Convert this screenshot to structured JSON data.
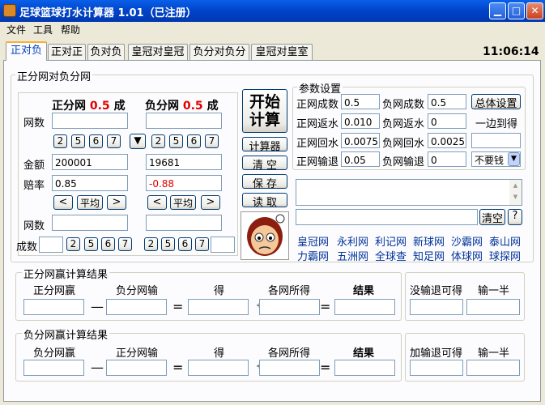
{
  "window": {
    "title": "足球篮球打水计算器 1.01（已注册）"
  },
  "menu": [
    "文件",
    "工具",
    "帮助"
  ],
  "tabs": [
    "正对负",
    "正对正",
    "负对负",
    "皇冠对皇冠",
    "负分对负分",
    "皇冠对皇室"
  ],
  "clock": "11:06:14",
  "main": {
    "group_title": "正分网对负分网",
    "left_header": "正分网",
    "right_header": "负分网",
    "left_handicap": "0.5",
    "right_handicap": "0.5",
    "cheng": "成",
    "label_wangshu": "网数",
    "label_amount": "金额",
    "label_rate": "赔率",
    "label_wangshu2": "网数",
    "label_chengshu": "成数",
    "left_amount": "200001",
    "right_amount": "19681",
    "left_rate": "0.85",
    "right_rate": "-0.88",
    "chips": [
      "2",
      "5",
      "6",
      "7"
    ],
    "arrow": "▼",
    "prev": "<",
    "avg": "平均",
    "next": ">",
    "start_line1": "开始",
    "start_line2": "计算",
    "calc": "计算器",
    "clear": "清 空",
    "save": "保 存",
    "read": "读 取"
  },
  "params": {
    "title": "参数设置",
    "zheng_cheng_label": "正网成数",
    "zheng_cheng": "0.5",
    "fu_cheng_label": "负网成数",
    "fu_cheng": "0.5",
    "zheng_fan_label": "正网返水",
    "zheng_fan": "0.010",
    "fu_fan_label": "负网返水",
    "fu_fan": "0",
    "zheng_hui_label": "正网回水",
    "zheng_hui": "0.0075",
    "fu_hui_label": "负网回水",
    "fu_hui": "0.0025",
    "zheng_shu_label": "正网输退",
    "zheng_shu": "0.05",
    "fu_shu_label": "负网输退",
    "fu_shu": "0",
    "overall": "总体设置",
    "side": "一边到得",
    "select": "不要钱",
    "clear": "清空",
    "help": "?"
  },
  "links": [
    "皇冠网",
    "永利网",
    "利记网",
    "新球网",
    "沙霸网",
    "泰山网",
    "力霸网",
    "五洲网",
    "全球查",
    "知足网",
    "体球网",
    "球探网"
  ],
  "res1": {
    "title": "正分网赢计算结果",
    "c1": "正分网赢",
    "c2": "负分网输",
    "c3": "得",
    "c4": "各网所得",
    "c5": "结果",
    "r1": "没输退可得",
    "r2": "输一半"
  },
  "res2": {
    "title": "负分网赢计算结果",
    "c1": "负分网赢",
    "c2": "正分网输",
    "c3": "得",
    "c4": "各网所得",
    "c5": "结果",
    "r1": "加输退可得",
    "r2": "输一半"
  },
  "ops": {
    "minus": "—",
    "eq": "=",
    "plus": "+"
  },
  "colors": {
    "accent": "#0A5FE8",
    "red": "#E00000",
    "link": "#003399"
  }
}
